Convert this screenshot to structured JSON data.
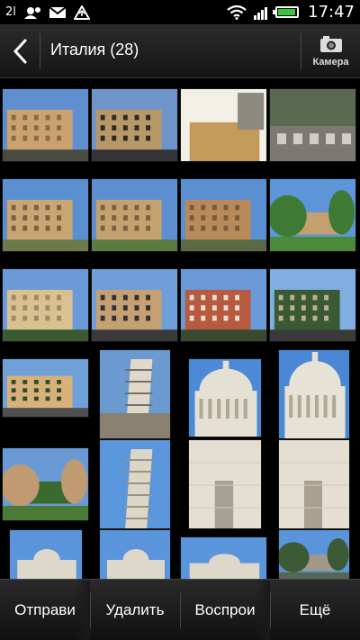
{
  "status_bar": {
    "notifications": "2l",
    "clock": "17:47",
    "icons": [
      "notification-icon",
      "voicemail-icon",
      "gmail-icon",
      "upload-icon",
      "wifi-icon",
      "signal-icon",
      "battery-icon"
    ]
  },
  "header": {
    "title": "Италия (28)",
    "back_icon": "chevron-left-icon",
    "camera_label": "Камера",
    "camera_icon": "camera-icon"
  },
  "bottom_bar": {
    "share_label": "Отправи",
    "delete_label": "Удалить",
    "play_label": "Воспрои",
    "more_label": "Ещё"
  },
  "photos": [
    {
      "sky": "#5f8fcf",
      "main": "#c9a270",
      "accent": "#8a6a45",
      "ground": "#4a4a40",
      "subject": "building"
    },
    {
      "sky": "#6f95c8",
      "main": "#b99868",
      "accent": "#2a2a2a",
      "ground": "#333338",
      "subject": "building"
    },
    {
      "sky": "#d9c9a8",
      "main": "#c49a5a",
      "accent": "#f2efe5",
      "ground": "#9a7a50",
      "subject": "interior"
    },
    {
      "sky": "#8a9aa0",
      "main": "#5a6a50",
      "accent": "#cfcfc8",
      "ground": "#7a7a72",
      "subject": "courtyard"
    },
    {
      "sky": "#5a8fd0",
      "main": "#c9a574",
      "accent": "#7a6040",
      "ground": "#6a7a4a",
      "subject": "building"
    },
    {
      "sky": "#5c8ed0",
      "main": "#c4a270",
      "accent": "#7a6040",
      "ground": "#5a7a40",
      "subject": "building"
    },
    {
      "sky": "#5a8fd2",
      "main": "#b88a5a",
      "accent": "#7a5a3a",
      "ground": "#5a6a45",
      "subject": "building"
    },
    {
      "sky": "#5d95d8",
      "main": "#3f7a35",
      "accent": "#c4a070",
      "ground": "#4a8a38",
      "subject": "trees"
    },
    {
      "sky": "#6a9ad8",
      "main": "#d8c090",
      "accent": "#a08860",
      "ground": "#3a5a30",
      "subject": "building"
    },
    {
      "sky": "#6f9fd8",
      "main": "#c4a072",
      "accent": "#303038",
      "ground": "#3a3a3a",
      "subject": "street"
    },
    {
      "sky": "#6a9ad8",
      "main": "#b85a40",
      "accent": "#e8e0d0",
      "ground": "#3a4a30",
      "subject": "building"
    },
    {
      "sky": "#80aee0",
      "main": "#3a5a35",
      "accent": "#c0b090",
      "ground": "#3a3a38",
      "subject": "street"
    },
    {
      "sky": "#6fa0d8",
      "main": "#d8b07a",
      "accent": "#2e4a2a",
      "ground": "#505050",
      "subject": "street"
    },
    {
      "sky": "#6a9ad0",
      "main": "#e0d8c8",
      "accent": "#707070",
      "ground": "#8a8070",
      "subject": "tower"
    },
    {
      "sky": "#4c8ad8",
      "main": "#e4e0d4",
      "accent": "#b0a890",
      "ground": "#c8c0b0",
      "subject": "dome"
    },
    {
      "sky": "#4a88d6",
      "main": "#e6e2d6",
      "accent": "#b0a890",
      "ground": "#c8c0b0",
      "subject": "dome"
    },
    {
      "sky": "#6a9ad6",
      "main": "#c09a70",
      "accent": "#3a6a30",
      "ground": "#4a7a38",
      "subject": "park"
    },
    {
      "sky": "#5a96dc",
      "main": "#dcd6c6",
      "accent": "#9a9282",
      "ground": "#dcd6c6",
      "subject": "leaning-tower"
    },
    {
      "sky": "#d8d2c2",
      "main": "#e4dfd2",
      "accent": "#a8a090",
      "ground": "#cfc8b8",
      "subject": "wall"
    },
    {
      "sky": "#d8d2c2",
      "main": "#e4dfd2",
      "accent": "#a8a090",
      "ground": "#cfc8b8",
      "subject": "wall"
    },
    {
      "sky": "#5a94da",
      "main": "#ddd8ca",
      "accent": "#a09888",
      "ground": "#556655",
      "subject": "cathedral"
    },
    {
      "sky": "#5a94da",
      "main": "#ddd8ca",
      "accent": "#a09888",
      "ground": "#556655",
      "subject": "cathedral"
    },
    {
      "sky": "#5a94da",
      "main": "#ddd8ca",
      "accent": "#a09888",
      "ground": "#556655",
      "subject": "cathedral"
    },
    {
      "sky": "#5a94da",
      "main": "#3c5a35",
      "accent": "#a09888",
      "ground": "#556655",
      "subject": "park"
    }
  ]
}
